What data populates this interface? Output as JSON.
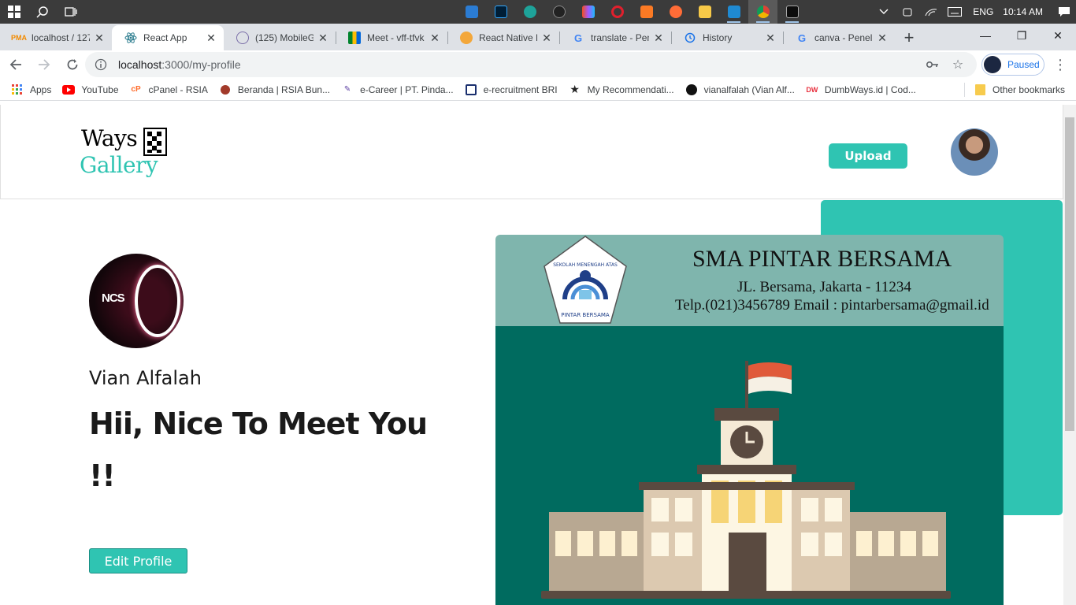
{
  "taskbar": {
    "language": "ENG",
    "time": "10:14 AM"
  },
  "tabs": [
    {
      "title": "localhost / 127",
      "favicon": "pma-icon"
    },
    {
      "title": "React App",
      "favicon": "react-icon"
    },
    {
      "title": "(125) MobileG",
      "favicon": "mobileg-icon"
    },
    {
      "title": "Meet - vff-tfvk",
      "favicon": "meet-icon"
    },
    {
      "title": "React Native D",
      "favicon": "react-native-icon"
    },
    {
      "title": "translate - Pen",
      "favicon": "google-icon"
    },
    {
      "title": "History",
      "favicon": "history-icon"
    },
    {
      "title": "canva - Penelu",
      "favicon": "google-icon"
    }
  ],
  "addressbar": {
    "host": "localhost",
    "path": ":3000/my-profile",
    "profile_status": "Paused"
  },
  "bookmarks": [
    {
      "label": "Apps",
      "icon": "apps-grid-icon",
      "color": "#ea4335"
    },
    {
      "label": "YouTube",
      "icon": "youtube-icon",
      "color": "#ff0000"
    },
    {
      "label": "cPanel - RSIA",
      "icon": "cpanel-icon",
      "color": "#ff6c2c"
    },
    {
      "label": "Beranda | RSIA Bun...",
      "icon": "rsia-icon",
      "color": "#a23a2a"
    },
    {
      "label": "e-Career | PT. Pinda...",
      "icon": "ecareer-icon",
      "color": "#5b3fa3"
    },
    {
      "label": "e-recruitment BRI",
      "icon": "bri-icon",
      "color": "#1a2f6e"
    },
    {
      "label": "My Recommendati...",
      "icon": "star-icon",
      "color": "#222222"
    },
    {
      "label": "vianalfalah (Vian Alf...",
      "icon": "github-icon",
      "color": "#111111"
    },
    {
      "label": "DumbWays.id | Cod...",
      "icon": "dumbways-icon",
      "color": "#e8303e"
    }
  ],
  "other_bookmarks": "Other bookmarks",
  "site": {
    "logo_top": "Ways",
    "logo_bottom": "Gallery",
    "upload_label": "Upload",
    "accent": "#2fc4b2"
  },
  "profile": {
    "name": "Vian Alfalah",
    "greeting": "Hii, Nice To Meet You !!",
    "edit_label": "Edit Profile",
    "avatar_text": "NCS"
  },
  "artwork": {
    "school_name": "SMA PINTAR BERSAMA",
    "address": "JL. Bersama, Jakarta - 11234",
    "contact": "Telp.(021)3456789 Email : pintarbersama@gmail.id",
    "emblem_arc_text": "SEKOLAH MENENGAH ATAS",
    "emblem_label": "PINTAR BERSAMA"
  }
}
